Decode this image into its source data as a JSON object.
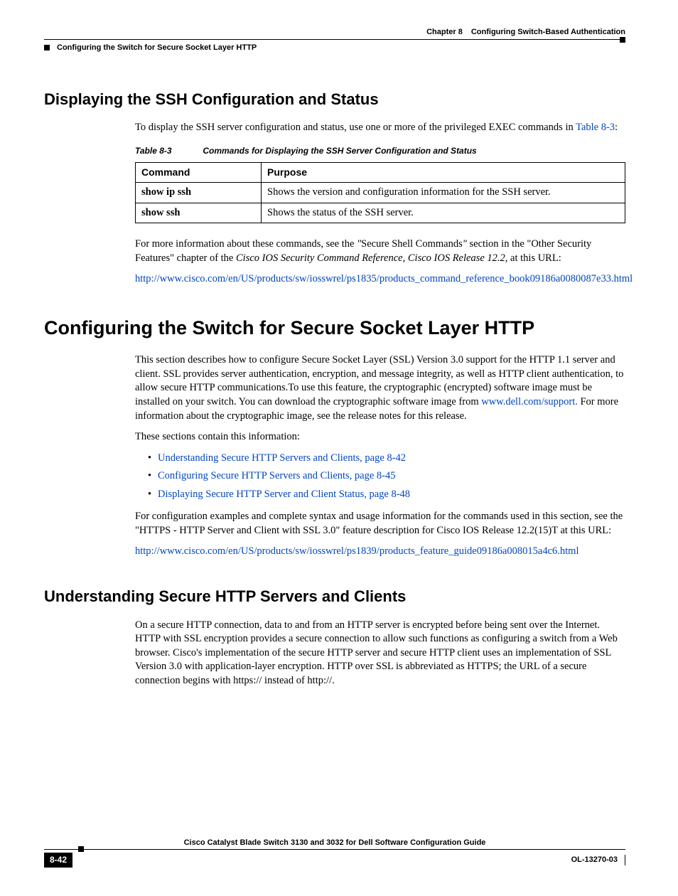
{
  "header": {
    "chapter_label": "Chapter 8",
    "chapter_title": "Configuring Switch-Based Authentication",
    "breadcrumb": "Configuring the Switch for Secure Socket Layer HTTP"
  },
  "sec1": {
    "heading": "Displaying the SSH Configuration and Status",
    "intro_a": "To display the SSH server configuration and status, use one or more of the privileged EXEC commands in ",
    "intro_link": "Table 8-3",
    "intro_b": ":",
    "table_num": "Table 8-3",
    "table_title": "Commands for Displaying the SSH Server Configuration and Status",
    "th_command": "Command",
    "th_purpose": "Purpose",
    "rows": [
      {
        "cmd": "show ip ssh",
        "purpose": "Shows the version and configuration information for the SSH server."
      },
      {
        "cmd": "show ssh",
        "purpose": "Shows the status of the SSH server."
      }
    ],
    "after_a": "For more information about these commands, see the ",
    "after_q1": "\"",
    "after_b": "Secure Shell Commands",
    "after_q2": "\"",
    "after_c": " section in the \"Other Security Features\" chapter of the ",
    "after_ital": "Cisco IOS Security Command Reference, Cisco IOS Release 12.2,",
    "after_d": " at this URL:",
    "url": "http://www.cisco.com/en/US/products/sw/iosswrel/ps1835/products_command_reference_book09186a0080087e33.html"
  },
  "sec2": {
    "heading": "Configuring the Switch for Secure Socket Layer HTTP",
    "p1_a": "This section describes how to configure Secure Socket Layer (SSL) Version 3.0 support for the HTTP 1.1 server and client. SSL provides server authentication, encryption, and message integrity, as well as HTTP client authentication, to allow secure HTTP communications.To use this feature, the cryptographic (encrypted) software image must be installed on your switch.  You can download the cryptographic software image from ",
    "p1_link": "www.dell.com/support.",
    "p1_b": " For more information about the cryptographic image, see the release notes for this release.",
    "p2": "These sections contain this information:",
    "toc": [
      "Understanding Secure HTTP Servers and Clients, page 8-42",
      "Configuring Secure HTTP Servers and Clients, page 8-45",
      "Displaying Secure HTTP Server and Client Status, page 8-48"
    ],
    "p3": "For configuration examples and complete syntax and usage information for the commands used in this section, see the \"HTTPS - HTTP Server and Client with SSL 3.0\" feature description for Cisco IOS Release 12.2(15)T at this URL:",
    "url": "http://www.cisco.com/en/US/products/sw/iosswrel/ps1839/products_feature_guide09186a008015a4c6.html"
  },
  "sec3": {
    "heading": "Understanding Secure HTTP Servers and Clients",
    "p1": "On a secure HTTP connection, data to and from an HTTP server is encrypted before being sent over the Internet. HTTP with SSL encryption provides a secure connection to allow such functions as configuring a switch from a Web browser. Cisco's implementation of the secure HTTP server and secure HTTP client uses an implementation of SSL Version 3.0 with application-layer encryption. HTTP over SSL is abbreviated as HTTPS; the URL of a secure connection begins with https:// instead of http://."
  },
  "footer": {
    "book_title": "Cisco Catalyst Blade Switch 3130 and 3032 for Dell Software Configuration Guide",
    "page": "8-42",
    "doc_id": "OL-13270-03"
  }
}
